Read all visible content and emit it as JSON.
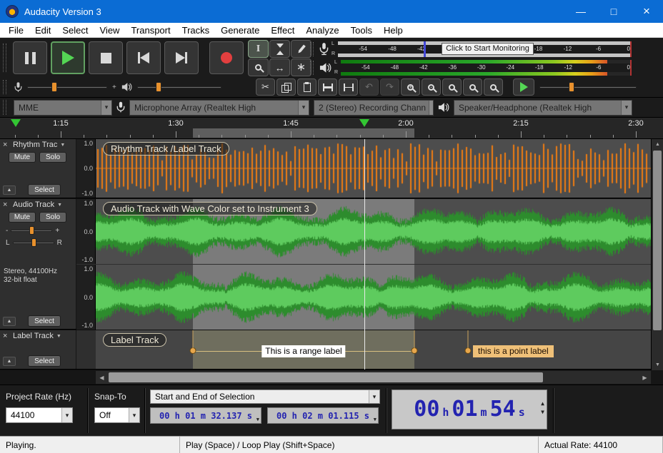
{
  "window": {
    "title": "Audacity Version 3",
    "minimize": "—",
    "maximize": "□",
    "close": "×"
  },
  "menu": {
    "items": [
      "File",
      "Edit",
      "Select",
      "View",
      "Transport",
      "Tracks",
      "Generate",
      "Effect",
      "Analyze",
      "Tools",
      "Help"
    ]
  },
  "meters": {
    "tooltip": "Click to Start Monitoring",
    "scale": [
      -54,
      -48,
      -42,
      -36,
      -30,
      -24,
      -18,
      -12,
      -6,
      0
    ],
    "channels": [
      "L",
      "R"
    ]
  },
  "devices": {
    "host": "MME",
    "input": "Microphone Array (Realtek High",
    "channels": "2 (Stereo) Recording Chann",
    "output": "Speaker/Headphone (Realtek High"
  },
  "timeline": {
    "labels": [
      "1:15",
      "1:30",
      "1:45",
      "2:00",
      "2:15",
      "2:30"
    ]
  },
  "tracks": {
    "rhythm": {
      "name": "Rhythm Trac",
      "mute": "Mute",
      "solo": "Solo",
      "select": "Select",
      "clip_label": "Rhythm Track /Label Track",
      "ruler": [
        "1.0",
        "0.0",
        "-1.0"
      ]
    },
    "audio": {
      "name": "Audio Track",
      "mute": "Mute",
      "solo": "Solo",
      "select": "Select",
      "clip_label": "Audio Track with Wave Color set to Instrument 3",
      "info1": "Stereo, 44100Hz",
      "info2": "32-bit float",
      "gain_minus": "-",
      "gain_plus": "+",
      "pan_l": "L",
      "pan_r": "R",
      "ruler": [
        "1.0",
        "0.0",
        "-1.0"
      ]
    },
    "label": {
      "name": "Label Track",
      "select": "Select",
      "clip_label": "Label Track",
      "range_label": "This is a range label",
      "point_label": "this is a point label"
    }
  },
  "selbar": {
    "rate_label": "Project Rate (Hz)",
    "rate_value": "44100",
    "snap_label": "Snap-To",
    "snap_value": "Off",
    "mode_value": "Start and End of Selection",
    "sel_start": "00 h 01 m 32.137 s",
    "sel_end": "00 h 02 m 01.115 s",
    "big": {
      "h": "00",
      "hu": "h",
      "m": "01",
      "mu": "m",
      "s": "54",
      "su": "s"
    }
  },
  "status": {
    "playing": "Playing.",
    "hint": "Play (Space) / Loop Play (Shift+Space)",
    "rate": "Actual Rate: 44100"
  },
  "colors": {
    "wave_orange": "#ef7d12",
    "wave_green": "#2d8c2d",
    "wave_green_light": "#5ecb5e"
  }
}
